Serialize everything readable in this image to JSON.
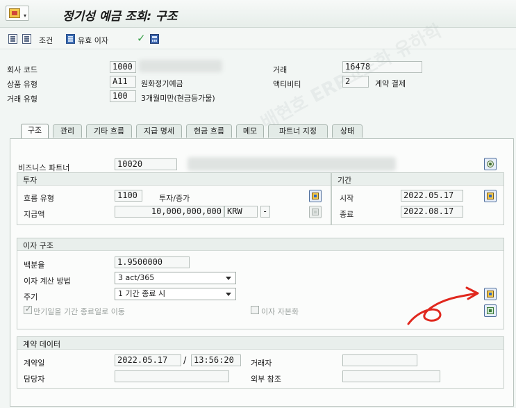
{
  "title": "정기성 예금 조회: 구조",
  "toolbar": {
    "conditions_label": "조건",
    "floating_interest_label": "유효 이자"
  },
  "header": {
    "company_code_label": "회사 코드",
    "company_code_value": "1000",
    "product_type_label": "상품 유형",
    "product_type_value": "A11",
    "product_type_desc": "원화정기예금",
    "transaction_type_label": "거래 유형",
    "transaction_type_value": "100",
    "transaction_type_desc": "3개월미만(현금등가물)",
    "transaction_label": "거래",
    "transaction_value": "16478",
    "activity_label": "액티비티",
    "activity_value": "2",
    "activity_desc": "계약 결제"
  },
  "tabs": [
    {
      "label": "구조"
    },
    {
      "label": "관리"
    },
    {
      "label": "기타 흐름"
    },
    {
      "label": "지급 명세"
    },
    {
      "label": "현금 흐름"
    },
    {
      "label": "메모"
    },
    {
      "label": "파트너 지정"
    },
    {
      "label": "상태"
    }
  ],
  "business_partner": {
    "label": "비즈니스 파트너",
    "value": "10020"
  },
  "investment": {
    "title": "투자",
    "flow_type_label": "흐름 유형",
    "flow_type_value": "1100",
    "flow_type_desc": "투자/증가",
    "amount_label": "지급액",
    "amount_value": "10,000,000,000",
    "currency_value": "KRW",
    "sign_value": "-"
  },
  "period": {
    "title": "기간",
    "start_label": "시작",
    "start_value": "2022.05.17",
    "end_label": "종료",
    "end_value": "2022.08.17"
  },
  "interest_structure": {
    "title": "이자 구조",
    "percentage_label": "백분율",
    "percentage_value": "1.9500000",
    "calc_method_label": "이자 계산 방법",
    "calc_method_value": "3 act/365",
    "cycle_label": "주기",
    "cycle_value": "1 기간 종료 시",
    "shift_maturity_label": "만기일을 기간 종료일로 이동",
    "shift_maturity_checked": true,
    "capitalization_label": "이자 자본화",
    "capitalization_checked": false
  },
  "contract_data": {
    "title": "계약 데이터",
    "contract_date_label": "계약일",
    "contract_date_value": "2022.05.17",
    "contract_time_value": "13:56:20",
    "separator": "/",
    "trader_label": "거래자",
    "trader_value": "",
    "responsible_label": "담당자",
    "responsible_value": "",
    "external_ref_label": "외부 참조",
    "external_ref_value": ""
  },
  "watermark": {
    "text": "배현호 ERP고도화 유하학"
  },
  "colors": {
    "annotation_red": "#e0281e",
    "panel_bg": "#fbfcfb",
    "app_bg": "#f2f6f4"
  }
}
